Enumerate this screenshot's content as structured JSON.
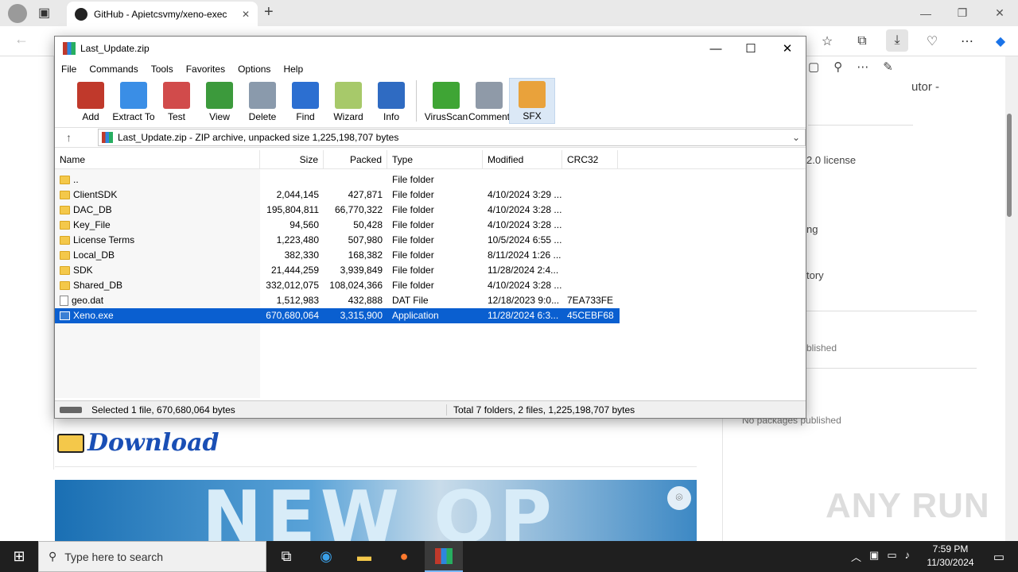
{
  "browser": {
    "tab_title": "GitHub - Apietcsvmy/xeno-exec",
    "new_tab": "+",
    "window_controls": [
      "—",
      "❐",
      "✕"
    ]
  },
  "github": {
    "side_texts": [
      "utor -",
      "2.0 license",
      "ng",
      "tory",
      "blished",
      "No packages published"
    ],
    "download_label": "Download",
    "banner_text": "NEW OP"
  },
  "watermark": "ANY RUN",
  "winrar": {
    "title": "Last_Update.zip",
    "menu": [
      "File",
      "Commands",
      "Tools",
      "Favorites",
      "Options",
      "Help"
    ],
    "tools": [
      {
        "label": "Add",
        "color": "#c0392b"
      },
      {
        "label": "Extract To",
        "color": "#3a8ee6"
      },
      {
        "label": "Test",
        "color": "#d14b4b"
      },
      {
        "label": "View",
        "color": "#3c9a3c"
      },
      {
        "label": "Delete",
        "color": "#8a9aac"
      },
      {
        "label": "Find",
        "color": "#2c6fd1"
      },
      {
        "label": "Wizard",
        "color": "#a7c96a"
      },
      {
        "label": "Info",
        "color": "#2f6bc2"
      },
      {
        "label": "VirusScan",
        "color": "#3fa535"
      },
      {
        "label": "Comment",
        "color": "#8f9aa8"
      },
      {
        "label": "SFX",
        "color": "#e9a23b"
      }
    ],
    "path": "Last_Update.zip - ZIP archive, unpacked size 1,225,198,707 bytes",
    "columns": [
      "Name",
      "Size",
      "Packed",
      "Type",
      "Modified",
      "CRC32"
    ],
    "rows": [
      {
        "name": "..",
        "size": "",
        "packed": "",
        "type": "File folder",
        "modified": "",
        "crc": "",
        "icon": "folder"
      },
      {
        "name": "ClientSDK",
        "size": "2,044,145",
        "packed": "427,871",
        "type": "File folder",
        "modified": "4/10/2024 3:29 ...",
        "crc": "",
        "icon": "folder"
      },
      {
        "name": "DAC_DB",
        "size": "195,804,811",
        "packed": "66,770,322",
        "type": "File folder",
        "modified": "4/10/2024 3:28 ...",
        "crc": "",
        "icon": "folder"
      },
      {
        "name": "Key_File",
        "size": "94,560",
        "packed": "50,428",
        "type": "File folder",
        "modified": "4/10/2024 3:28 ...",
        "crc": "",
        "icon": "folder"
      },
      {
        "name": "License Terms",
        "size": "1,223,480",
        "packed": "507,980",
        "type": "File folder",
        "modified": "10/5/2024 6:55 ...",
        "crc": "",
        "icon": "folder"
      },
      {
        "name": "Local_DB",
        "size": "382,330",
        "packed": "168,382",
        "type": "File folder",
        "modified": "8/11/2024 1:26 ...",
        "crc": "",
        "icon": "folder"
      },
      {
        "name": "SDK",
        "size": "21,444,259",
        "packed": "3,939,849",
        "type": "File folder",
        "modified": "11/28/2024 2:4...",
        "crc": "",
        "icon": "folder"
      },
      {
        "name": "Shared_DB",
        "size": "332,012,075",
        "packed": "108,024,366",
        "type": "File folder",
        "modified": "4/10/2024 3:28 ...",
        "crc": "",
        "icon": "folder"
      },
      {
        "name": "geo.dat",
        "size": "1,512,983",
        "packed": "432,888",
        "type": "DAT File",
        "modified": "12/18/2023 9:0...",
        "crc": "7EA733FE",
        "icon": "file"
      },
      {
        "name": "Xeno.exe",
        "size": "670,680,064",
        "packed": "3,315,900",
        "type": "Application",
        "modified": "11/28/2024 6:3...",
        "crc": "45CEBF68",
        "icon": "app"
      }
    ],
    "status_left": "Selected 1 file, 670,680,064 bytes",
    "status_right": "Total 7 folders, 2 files, 1,225,198,707 bytes"
  },
  "taskbar": {
    "search_placeholder": "Type here to search",
    "time": "7:59 PM",
    "date": "11/30/2024"
  }
}
